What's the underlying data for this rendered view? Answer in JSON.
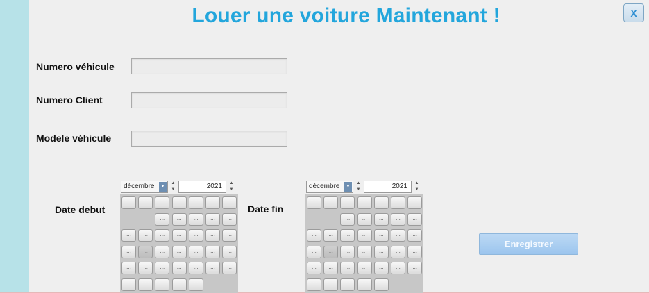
{
  "window": {
    "title": "Louer une voiture Maintenant !",
    "close_label": "X"
  },
  "form": {
    "fields": [
      {
        "label": "Numero véhicule",
        "value": ""
      },
      {
        "label": "Numero Client",
        "value": ""
      },
      {
        "label": "Modele véhicule",
        "value": ""
      }
    ],
    "date_start_label": "Date debut",
    "date_end_label": "Date fin",
    "calendars": [
      {
        "month": "décembre",
        "year": "2021",
        "day_button_text": "..."
      },
      {
        "month": "décembre",
        "year": "2021",
        "day_button_text": "..."
      }
    ],
    "save_label": "Enregistrer"
  },
  "colors": {
    "accent": "#23a6dc",
    "side_strip": "#b7e2e8",
    "button": "#9cc5ee"
  }
}
